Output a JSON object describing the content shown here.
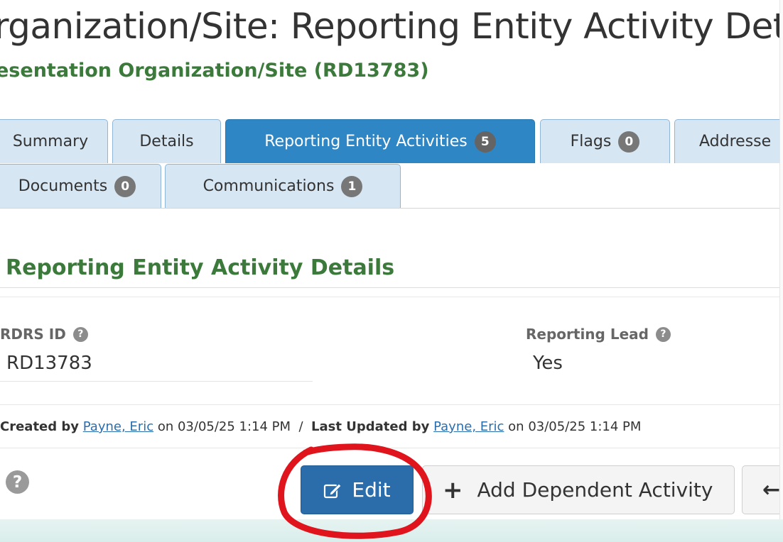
{
  "header": {
    "title": "rganization/Site: Reporting Entity Activity Det",
    "subtitle": "esentation Organization/Site (RD13783)"
  },
  "tabs": {
    "row1": [
      {
        "label": "Summary",
        "badge": null,
        "active": false
      },
      {
        "label": "Details",
        "badge": null,
        "active": false
      },
      {
        "label": "Reporting Entity Activities",
        "badge": "5",
        "active": true
      },
      {
        "label": "Flags",
        "badge": "0",
        "active": false
      },
      {
        "label": "Addresse",
        "badge": null,
        "active": false
      }
    ],
    "row2": [
      {
        "label": "Documents",
        "badge": "0",
        "active": false
      },
      {
        "label": "Communications",
        "badge": "1",
        "active": false
      }
    ]
  },
  "section": {
    "title": "Reporting Entity Activity Details"
  },
  "fields": {
    "rdrs_id": {
      "label": "RDRS ID",
      "value": "RD13783",
      "help_icon": "question-circle-icon"
    },
    "reporting_lead": {
      "label": "Reporting Lead",
      "value": "Yes",
      "help_icon": "question-circle-icon"
    }
  },
  "audit": {
    "created_label": "Created by",
    "created_by": "Payne, Eric",
    "created_on": "on 03/05/25 1:14 PM",
    "separator": "/",
    "updated_label": "Last Updated by",
    "updated_by": "Payne, Eric",
    "updated_on": "on 03/05/25 1:14 PM"
  },
  "actions": {
    "help_icon": "question-circle-icon",
    "edit_label": "Edit",
    "edit_icon": "pencil-square-icon",
    "add_label": "Add Dependent Activity",
    "add_icon": "plus-icon",
    "back_icon": "arrow-left-icon"
  },
  "colors": {
    "accent_blue": "#2f86c5",
    "button_blue": "#2b6cab",
    "heading_green": "#3b7a3b",
    "tab_bg": "#d6e6f3",
    "annotation_red": "#e0141c"
  }
}
